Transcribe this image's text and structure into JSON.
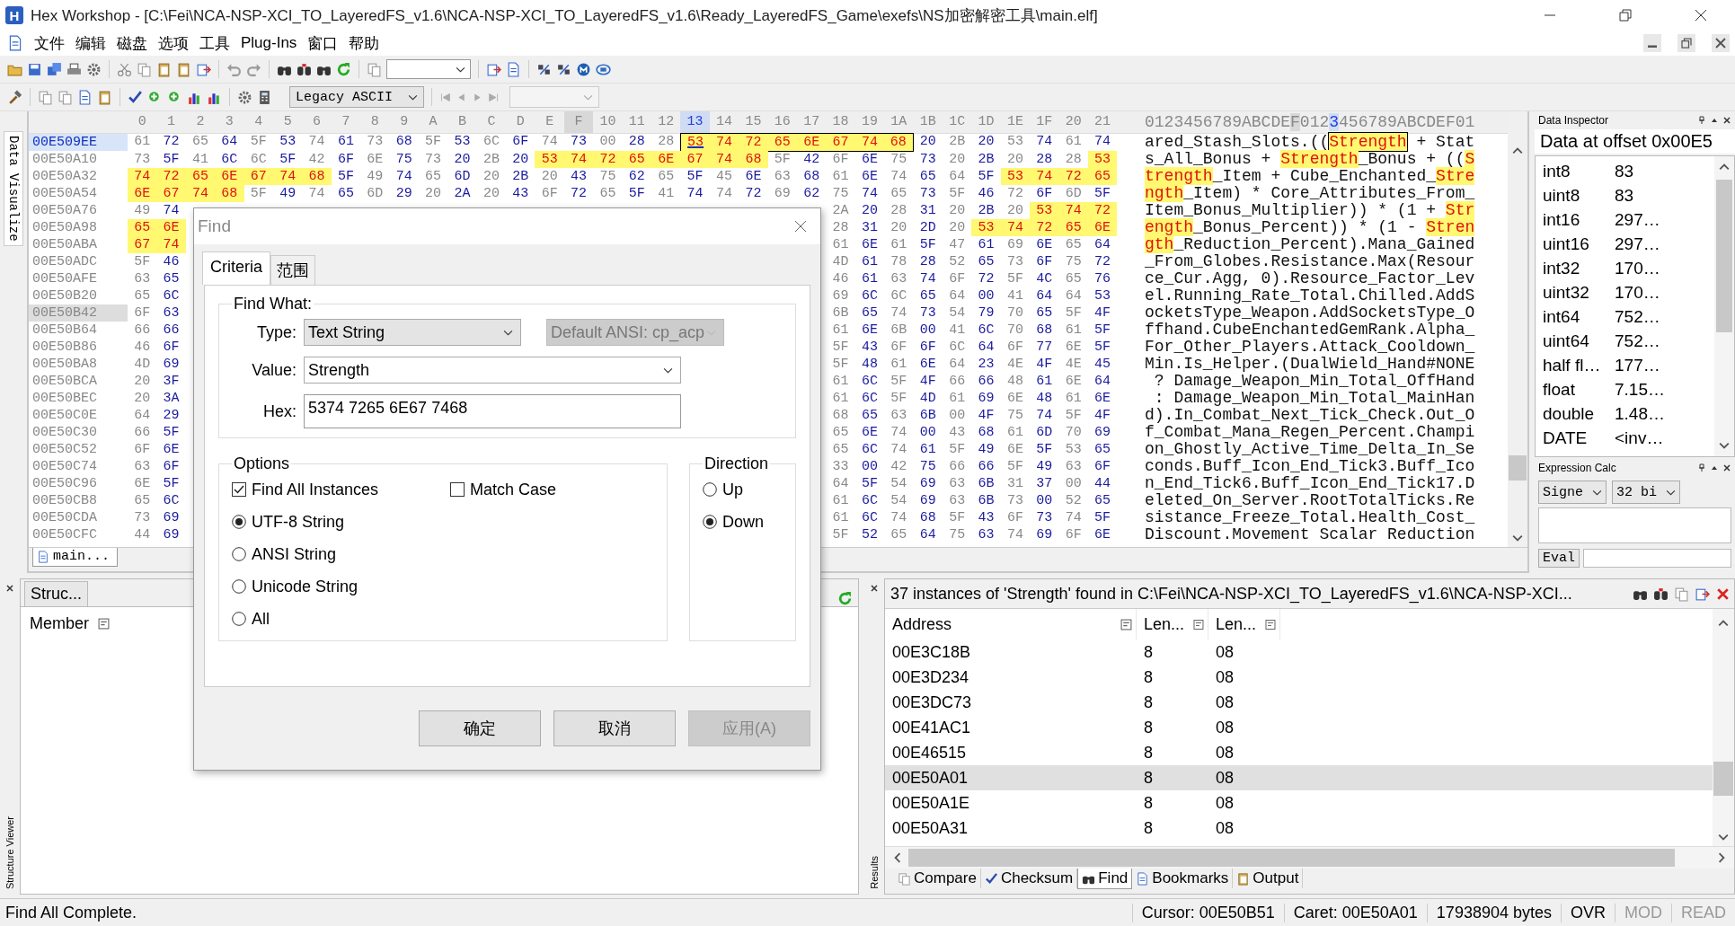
{
  "window": {
    "icon_letter": "H",
    "title": "Hex Workshop - [C:\\Fei\\NCA-NSP-XCI_TO_LayeredFS_v1.6\\NCA-NSP-XCI_TO_LayeredFS_v1.6\\Ready_LayeredFS_Game\\exefs\\NS加密解密工具\\main.elf]"
  },
  "menu": [
    "文件",
    "编辑",
    "磁盘",
    "选项",
    "工具",
    "Plug-Ins",
    "窗口",
    "帮助"
  ],
  "toolbar": {
    "charset": "Legacy ASCII"
  },
  "side_tabs": {
    "top": "Data Visualize",
    "structure": "Structure Viewer",
    "results": "Results"
  },
  "hex_editor": {
    "columns": [
      {
        "label": "0",
        "caret": false,
        "cursor": false
      },
      {
        "label": "1",
        "caret": false,
        "cursor": false
      },
      {
        "label": "2",
        "caret": false,
        "cursor": false
      },
      {
        "label": "3",
        "caret": false,
        "cursor": false
      },
      {
        "label": "4",
        "caret": false,
        "cursor": false
      },
      {
        "label": "5",
        "caret": false,
        "cursor": false
      },
      {
        "label": "6",
        "caret": false,
        "cursor": false
      },
      {
        "label": "7",
        "caret": false,
        "cursor": false
      },
      {
        "label": "8",
        "caret": false,
        "cursor": false
      },
      {
        "label": "9",
        "caret": false,
        "cursor": false
      },
      {
        "label": "A",
        "caret": false,
        "cursor": false
      },
      {
        "label": "B",
        "caret": false,
        "cursor": false
      },
      {
        "label": "C",
        "caret": false,
        "cursor": false
      },
      {
        "label": "D",
        "caret": false,
        "cursor": false
      },
      {
        "label": "E",
        "caret": false,
        "cursor": false
      },
      {
        "label": "F",
        "caret": false,
        "cursor": true
      },
      {
        "label": "10",
        "caret": false,
        "cursor": false
      },
      {
        "label": "11",
        "caret": false,
        "cursor": false
      },
      {
        "label": "12",
        "caret": false,
        "cursor": false
      },
      {
        "label": "13",
        "caret": true,
        "cursor": false
      },
      {
        "label": "14",
        "caret": false,
        "cursor": false
      },
      {
        "label": "15",
        "caret": false,
        "cursor": false
      },
      {
        "label": "16",
        "caret": false,
        "cursor": false
      },
      {
        "label": "17",
        "caret": false,
        "cursor": false
      },
      {
        "label": "18",
        "caret": false,
        "cursor": false
      },
      {
        "label": "19",
        "caret": false,
        "cursor": false
      },
      {
        "label": "1A",
        "caret": false,
        "cursor": false
      },
      {
        "label": "1B",
        "caret": false,
        "cursor": false
      },
      {
        "label": "1C",
        "caret": false,
        "cursor": false
      },
      {
        "label": "1D",
        "caret": false,
        "cursor": false
      },
      {
        "label": "1E",
        "caret": false,
        "cursor": false
      },
      {
        "label": "1F",
        "caret": false,
        "cursor": false
      },
      {
        "label": "20",
        "caret": false,
        "cursor": false
      },
      {
        "label": "21",
        "caret": false,
        "cursor": false
      }
    ],
    "ascii_header": [
      {
        "text": "0123456789ABCDE",
        "kind": "plain"
      },
      {
        "text": "F",
        "kind": "cursor"
      },
      {
        "text": "012",
        "kind": "plain"
      },
      {
        "text": "3",
        "kind": "caret"
      },
      {
        "text": "456789ABCDEF01",
        "kind": "plain"
      }
    ],
    "rows": [
      {
        "address": "00E509EE",
        "caret": true,
        "cursor": false,
        "hex": [
          {
            "bytes": [
              "61",
              "72",
              "65",
              "64",
              "5F",
              "53",
              "74",
              "61",
              "73",
              "68",
              "5F",
              "53",
              "6C",
              "6F",
              "74",
              "73",
              "00",
              "28",
              "28"
            ],
            "kind": "plain"
          },
          {
            "bytes": [
              "53",
              "74",
              "72",
              "65",
              "6E",
              "67",
              "74",
              "68"
            ],
            "kind": "current"
          },
          {
            "bytes": [
              "20",
              "2B",
              "20",
              "53",
              "74",
              "61",
              "74"
            ],
            "kind": "plain"
          }
        ],
        "ascii": [
          {
            "text": "ared_Stash_Slots.((",
            "kind": "plain"
          },
          {
            "text": "Strength",
            "kind": "current"
          },
          {
            "text": " + Stat",
            "kind": "plain"
          }
        ]
      },
      {
        "address": "00E50A10",
        "caret": false,
        "cursor": false,
        "hex": [
          {
            "bytes": [
              "73",
              "5F",
              "41",
              "6C",
              "6C",
              "5F",
              "42",
              "6F",
              "6E",
              "75",
              "73",
              "20",
              "2B",
              "20"
            ],
            "kind": "plain"
          },
          {
            "bytes": [
              "53",
              "74",
              "72",
              "65",
              "6E",
              "67",
              "74",
              "68"
            ],
            "kind": "match"
          },
          {
            "bytes": [
              "5F",
              "42",
              "6F",
              "6E",
              "75",
              "73",
              "20",
              "2B",
              "20",
              "28",
              "28"
            ],
            "kind": "plain"
          },
          {
            "bytes": [
              "53"
            ],
            "kind": "match"
          }
        ],
        "ascii": [
          {
            "text": "s_All_Bonus + ",
            "kind": "plain"
          },
          {
            "text": "Strength",
            "kind": "match"
          },
          {
            "text": "_Bonus + ((",
            "kind": "plain"
          },
          {
            "text": "S",
            "kind": "match"
          }
        ]
      },
      {
        "address": "00E50A32",
        "caret": false,
        "cursor": false,
        "hex": [
          {
            "bytes": [
              "74",
              "72",
              "65",
              "6E",
              "67",
              "74",
              "68"
            ],
            "kind": "match"
          },
          {
            "bytes": [
              "5F",
              "49",
              "74",
              "65",
              "6D",
              "20",
              "2B",
              "20",
              "43",
              "75",
              "62",
              "65",
              "5F",
              "45",
              "6E",
              "63",
              "68",
              "61",
              "6E",
              "74",
              "65",
              "64",
              "5F"
            ],
            "kind": "plain"
          },
          {
            "bytes": [
              "53",
              "74",
              "72",
              "65"
            ],
            "kind": "match"
          }
        ],
        "ascii": [
          {
            "text": "trength",
            "kind": "match"
          },
          {
            "text": "_Item + Cube_Enchanted_",
            "kind": "plain"
          },
          {
            "text": "Stre",
            "kind": "match"
          }
        ]
      },
      {
        "address": "00E50A54",
        "caret": false,
        "cursor": false,
        "hex": [
          {
            "bytes": [
              "6E",
              "67",
              "74",
              "68"
            ],
            "kind": "match"
          },
          {
            "bytes": [
              "5F",
              "49",
              "74",
              "65",
              "6D",
              "29",
              "20",
              "2A",
              "20",
              "43",
              "6F",
              "72",
              "65",
              "5F",
              "41",
              "74",
              "74",
              "72",
              "69",
              "62",
              "75",
              "74",
              "65",
              "73",
              "5F",
              "46",
              "72",
              "6F",
              "6D",
              "5F"
            ],
            "kind": "plain"
          }
        ],
        "ascii": [
          {
            "text": "ngth",
            "kind": "match"
          },
          {
            "text": "_Item) * Core_Attributes_From_",
            "kind": "plain"
          }
        ]
      },
      {
        "address": "00E50A76",
        "caret": false,
        "cursor": false,
        "hex_start": [
          {
            "bytes": [
              "49",
              "74"
            ],
            "kind": "plain"
          }
        ],
        "hex_end": [
          {
            "bytes": [
              "2A",
              "20",
              "28",
              "31",
              "20",
              "2B",
              "20"
            ],
            "kind": "plain"
          },
          {
            "bytes": [
              "53",
              "74",
              "72"
            ],
            "kind": "match"
          }
        ],
        "ascii": [
          {
            "text": "Item_Bonus_Multiplier)) * (1 + ",
            "kind": "plain"
          },
          {
            "text": "Str",
            "kind": "match"
          }
        ]
      },
      {
        "address": "00E50A98",
        "caret": false,
        "cursor": false,
        "hex_start": [
          {
            "bytes": [
              "65",
              "6E"
            ],
            "kind": "match"
          }
        ],
        "hex_end": [
          {
            "bytes": [
              "28",
              "31",
              "20",
              "2D",
              "20"
            ],
            "kind": "plain"
          },
          {
            "bytes": [
              "53",
              "74",
              "72",
              "65",
              "6E"
            ],
            "kind": "match"
          }
        ],
        "ascii": [
          {
            "text": "ength",
            "kind": "match"
          },
          {
            "text": "_Bonus_Percent)) * (1 - ",
            "kind": "plain"
          },
          {
            "text": "Stren",
            "kind": "match"
          }
        ]
      },
      {
        "address": "00E50ABA",
        "caret": false,
        "cursor": false,
        "hex_start": [
          {
            "bytes": [
              "67",
              "74"
            ],
            "kind": "match"
          }
        ],
        "hex_end": [
          {
            "bytes": [
              "61",
              "6E",
              "61",
              "5F",
              "47",
              "61",
              "69",
              "6E",
              "65",
              "64"
            ],
            "kind": "plain"
          }
        ],
        "ascii": [
          {
            "text": "gth",
            "kind": "match"
          },
          {
            "text": "_Reduction_Percent).Mana_Gained",
            "kind": "plain"
          }
        ]
      },
      {
        "address": "00E50ADC",
        "caret": false,
        "cursor": false,
        "hex_start": [
          {
            "bytes": [
              "5F",
              "46"
            ],
            "kind": "plain"
          }
        ],
        "hex_end": [
          {
            "bytes": [
              "4D",
              "61",
              "78",
              "28",
              "52",
              "65",
              "73",
              "6F",
              "75",
              "72"
            ],
            "kind": "plain"
          }
        ],
        "ascii": [
          {
            "text": "_From_Globes.Resistance.Max(Resour",
            "kind": "plain"
          }
        ]
      },
      {
        "address": "00E50AFE",
        "caret": false,
        "cursor": false,
        "hex_start": [
          {
            "bytes": [
              "63",
              "65"
            ],
            "kind": "plain"
          }
        ],
        "hex_end": [
          {
            "bytes": [
              "46",
              "61",
              "63",
              "74",
              "6F",
              "72",
              "5F",
              "4C",
              "65",
              "76"
            ],
            "kind": "plain"
          }
        ],
        "ascii": [
          {
            "text": "ce_Cur.Agg, 0).Resource_Factor_Lev",
            "kind": "plain"
          }
        ]
      },
      {
        "address": "00E50B20",
        "caret": false,
        "cursor": false,
        "hex_start": [
          {
            "bytes": [
              "65",
              "6C"
            ],
            "kind": "plain"
          }
        ],
        "hex_end": [
          {
            "bytes": [
              "69",
              "6C",
              "6C",
              "65",
              "64",
              "00",
              "41",
              "64",
              "64",
              "53"
            ],
            "kind": "plain"
          }
        ],
        "ascii": [
          {
            "text": "el.Running_Rate_Total.Chilled.AddS",
            "kind": "plain"
          }
        ]
      },
      {
        "address": "00E50B42",
        "caret": false,
        "cursor": true,
        "hex_start": [
          {
            "bytes": [
              "6F",
              "63"
            ],
            "kind": "plain"
          }
        ],
        "hex_end": [
          {
            "bytes": [
              "6B",
              "65",
              "74",
              "73",
              "54",
              "79",
              "70",
              "65",
              "5F",
              "4F"
            ],
            "kind": "plain"
          }
        ],
        "ascii": [
          {
            "text": "ocketsType_Weapon.AddSocketsType_O",
            "kind": "plain"
          }
        ]
      },
      {
        "address": "00E50B64",
        "caret": false,
        "cursor": false,
        "hex_start": [
          {
            "bytes": [
              "66",
              "66"
            ],
            "kind": "plain"
          }
        ],
        "hex_end": [
          {
            "bytes": [
              "61",
              "6E",
              "6B",
              "00",
              "41",
              "6C",
              "70",
              "68",
              "61",
              "5F"
            ],
            "kind": "plain"
          }
        ],
        "ascii": [
          {
            "text": "ffhand.CubeEnchantedGemRank.Alpha_",
            "kind": "plain"
          }
        ]
      },
      {
        "address": "00E50B86",
        "caret": false,
        "cursor": false,
        "hex_start": [
          {
            "bytes": [
              "46",
              "6F"
            ],
            "kind": "plain"
          }
        ],
        "hex_end": [
          {
            "bytes": [
              "5F",
              "43",
              "6F",
              "6F",
              "6C",
              "64",
              "6F",
              "77",
              "6E",
              "5F"
            ],
            "kind": "plain"
          }
        ],
        "ascii": [
          {
            "text": "For_Other_Players.Attack_Cooldown_",
            "kind": "plain"
          }
        ]
      },
      {
        "address": "00E50BA8",
        "caret": false,
        "cursor": false,
        "hex_start": [
          {
            "bytes": [
              "4D",
              "69"
            ],
            "kind": "plain"
          }
        ],
        "hex_end": [
          {
            "bytes": [
              "5F",
              "48",
              "61",
              "6E",
              "64",
              "23",
              "4E",
              "4F",
              "4E",
              "45"
            ],
            "kind": "plain"
          }
        ],
        "ascii": [
          {
            "text": "Min.Is_Helper.(DualWield_Hand#NONE",
            "kind": "plain"
          }
        ]
      },
      {
        "address": "00E50BCA",
        "caret": false,
        "cursor": false,
        "hex_start": [
          {
            "bytes": [
              "20",
              "3F"
            ],
            "kind": "plain"
          }
        ],
        "hex_end": [
          {
            "bytes": [
              "61",
              "6C",
              "5F",
              "4F",
              "66",
              "66",
              "48",
              "61",
              "6E",
              "64"
            ],
            "kind": "plain"
          }
        ],
        "ascii": [
          {
            "text": " ? Damage_Weapon_Min_Total_OffHand",
            "kind": "plain"
          }
        ]
      },
      {
        "address": "00E50BEC",
        "caret": false,
        "cursor": false,
        "hex_start": [
          {
            "bytes": [
              "20",
              "3A"
            ],
            "kind": "plain"
          }
        ],
        "hex_end": [
          {
            "bytes": [
              "61",
              "6C",
              "5F",
              "4D",
              "61",
              "69",
              "6E",
              "48",
              "61",
              "6E"
            ],
            "kind": "plain"
          }
        ],
        "ascii": [
          {
            "text": " : Damage_Weapon_Min_Total_MainHan",
            "kind": "plain"
          }
        ]
      },
      {
        "address": "00E50C0E",
        "caret": false,
        "cursor": false,
        "hex_start": [
          {
            "bytes": [
              "64",
              "29"
            ],
            "kind": "plain"
          }
        ],
        "hex_end": [
          {
            "bytes": [
              "68",
              "65",
              "63",
              "6B",
              "00",
              "4F",
              "75",
              "74",
              "5F",
              "4F"
            ],
            "kind": "plain"
          }
        ],
        "ascii": [
          {
            "text": "d).In_Combat_Next_Tick_Check.Out_O",
            "kind": "plain"
          }
        ]
      },
      {
        "address": "00E50C30",
        "caret": false,
        "cursor": false,
        "hex_start": [
          {
            "bytes": [
              "66",
              "5F"
            ],
            "kind": "plain"
          }
        ],
        "hex_end": [
          {
            "bytes": [
              "65",
              "6E",
              "74",
              "00",
              "43",
              "68",
              "61",
              "6D",
              "70",
              "69"
            ],
            "kind": "plain"
          }
        ],
        "ascii": [
          {
            "text": "f_Combat_Mana_Regen_Percent.Champi",
            "kind": "plain"
          }
        ]
      },
      {
        "address": "00E50C52",
        "caret": false,
        "cursor": false,
        "hex_start": [
          {
            "bytes": [
              "6F",
              "6E"
            ],
            "kind": "plain"
          }
        ],
        "hex_end": [
          {
            "bytes": [
              "65",
              "6C",
              "74",
              "61",
              "5F",
              "49",
              "6E",
              "5F",
              "53",
              "65"
            ],
            "kind": "plain"
          }
        ],
        "ascii": [
          {
            "text": "on_Ghostly_Active_Time_Delta_In_Se",
            "kind": "plain"
          }
        ]
      },
      {
        "address": "00E50C74",
        "caret": false,
        "cursor": false,
        "hex_start": [
          {
            "bytes": [
              "63",
              "6F"
            ],
            "kind": "plain"
          }
        ],
        "hex_end": [
          {
            "bytes": [
              "33",
              "00",
              "42",
              "75",
              "66",
              "66",
              "5F",
              "49",
              "63",
              "6F"
            ],
            "kind": "plain"
          }
        ],
        "ascii": [
          {
            "text": "conds.Buff_Icon_End_Tick3.Buff_Ico",
            "kind": "plain"
          }
        ]
      },
      {
        "address": "00E50C96",
        "caret": false,
        "cursor": false,
        "hex_start": [
          {
            "bytes": [
              "6E",
              "5F"
            ],
            "kind": "plain"
          }
        ],
        "hex_end": [
          {
            "bytes": [
              "64",
              "5F",
              "54",
              "69",
              "63",
              "6B",
              "31",
              "37",
              "00",
              "44"
            ],
            "kind": "plain"
          }
        ],
        "ascii": [
          {
            "text": "n_End_Tick6.Buff_Icon_End_Tick17.D",
            "kind": "plain"
          }
        ]
      },
      {
        "address": "00E50CB8",
        "caret": false,
        "cursor": false,
        "hex_start": [
          {
            "bytes": [
              "65",
              "6C"
            ],
            "kind": "plain"
          }
        ],
        "hex_end": [
          {
            "bytes": [
              "61",
              "6C",
              "54",
              "69",
              "63",
              "6B",
              "73",
              "00",
              "52",
              "65"
            ],
            "kind": "plain"
          }
        ],
        "ascii": [
          {
            "text": "eleted_On_Server.RootTotalTicks.Re",
            "kind": "plain"
          }
        ]
      },
      {
        "address": "00E50CDA",
        "caret": false,
        "cursor": false,
        "hex_start": [
          {
            "bytes": [
              "73",
              "69"
            ],
            "kind": "plain"
          }
        ],
        "hex_end": [
          {
            "bytes": [
              "61",
              "6C",
              "74",
              "68",
              "5F",
              "43",
              "6F",
              "73",
              "74",
              "5F"
            ],
            "kind": "plain"
          }
        ],
        "ascii": [
          {
            "text": "sistance_Freeze_Total.Health_Cost_",
            "kind": "plain"
          }
        ]
      },
      {
        "address": "00E50CFC",
        "caret": false,
        "cursor": false,
        "hex_start": [
          {
            "bytes": [
              "44",
              "69"
            ],
            "kind": "plain"
          }
        ],
        "hex_end": [
          {
            "bytes": [
              "5F",
              "52",
              "65",
              "64",
              "75",
              "63",
              "74",
              "69",
              "6F",
              "6E"
            ],
            "kind": "plain"
          }
        ],
        "ascii": [
          {
            "text": "Discount.Movement Scalar Reduction",
            "kind": "plain"
          }
        ]
      }
    ],
    "document_tab": "main..."
  },
  "data_inspector": {
    "title": "Data Inspector",
    "heading": "Data at offset 0x00E5",
    "rows": [
      {
        "type": "int8",
        "value": "83"
      },
      {
        "type": "uint8",
        "value": "83"
      },
      {
        "type": "int16",
        "value": "297…"
      },
      {
        "type": "uint16",
        "value": "297…"
      },
      {
        "type": "int32",
        "value": "170…"
      },
      {
        "type": "uint32",
        "value": "170…"
      },
      {
        "type": "int64",
        "value": "752…"
      },
      {
        "type": "uint64",
        "value": "752…"
      },
      {
        "type": "half fl…",
        "value": "177…"
      },
      {
        "type": "float",
        "value": "7.15…"
      },
      {
        "type": "double",
        "value": "1.48…"
      },
      {
        "type": "DATE",
        "value": "<inv…"
      }
    ]
  },
  "expression_calc": {
    "title": "Expression Calc",
    "sign": "Signe",
    "bits": "32 bi",
    "eval": "Eval"
  },
  "structure_viewer": {
    "tab": "Struc...",
    "column": "Member"
  },
  "results": {
    "summary": "37 instances of 'Strength' found in C:\\Fei\\NCA-NSP-XCI_TO_LayeredFS_v1.6\\NCA-NSP-XCI...",
    "columns": [
      "Address",
      "Len...",
      "Len..."
    ],
    "rows": [
      {
        "address": "00E3C18B",
        "length": "8",
        "length_hex": "08",
        "selected": false
      },
      {
        "address": "00E3D234",
        "length": "8",
        "length_hex": "08",
        "selected": false
      },
      {
        "address": "00E3DC73",
        "length": "8",
        "length_hex": "08",
        "selected": false
      },
      {
        "address": "00E41AC1",
        "length": "8",
        "length_hex": "08",
        "selected": false
      },
      {
        "address": "00E46515",
        "length": "8",
        "length_hex": "08",
        "selected": false
      },
      {
        "address": "00E50A01",
        "length": "8",
        "length_hex": "08",
        "selected": true
      },
      {
        "address": "00E50A1E",
        "length": "8",
        "length_hex": "08",
        "selected": false
      },
      {
        "address": "00E50A31",
        "length": "8",
        "length_hex": "08",
        "selected": false
      }
    ],
    "tabs": [
      {
        "label": "Compare",
        "selected": false
      },
      {
        "label": "Checksum",
        "selected": false
      },
      {
        "label": "Find",
        "selected": true
      },
      {
        "label": "Bookmarks",
        "selected": false
      },
      {
        "label": "Output",
        "selected": false
      }
    ]
  },
  "status_bar": {
    "message": "Find All Complete.",
    "items": [
      {
        "text": "Cursor: 00E50B51",
        "active": true
      },
      {
        "text": "Caret: 00E50A01",
        "active": true
      },
      {
        "text": "17938904 bytes",
        "active": true
      },
      {
        "text": "OVR",
        "active": true
      },
      {
        "text": "MOD",
        "active": false
      },
      {
        "text": "READ",
        "active": false
      }
    ]
  },
  "find_dialog": {
    "title": "Find",
    "tabs": [
      {
        "label": "Criteria",
        "selected": true
      },
      {
        "label": "范围",
        "selected": false
      }
    ],
    "find_what": {
      "title": "Find What:",
      "type_label": "Type:",
      "type_value": "Text String",
      "encoding": {
        "value": "Default ANSI: cp_acp",
        "disabled": true
      },
      "value_label": "Value:",
      "value": "Strength",
      "hex_label": "Hex:",
      "hex": "5374 7265 6E67 7468"
    },
    "options": {
      "title": "Options",
      "checkboxes": [
        {
          "label": "Find All Instances",
          "checked": true
        },
        {
          "label": "Match Case",
          "checked": false
        }
      ],
      "radios": [
        {
          "label": "UTF-8 String",
          "selected": true
        },
        {
          "label": "ANSI String",
          "selected": false
        },
        {
          "label": "Unicode String",
          "selected": false
        },
        {
          "label": "All",
          "selected": false
        }
      ]
    },
    "direction": {
      "title": "Direction",
      "radios": [
        {
          "label": "Up",
          "selected": false
        },
        {
          "label": "Down",
          "selected": true
        }
      ]
    },
    "buttons": [
      {
        "label": "确定",
        "disabled": false
      },
      {
        "label": "取消",
        "disabled": false
      },
      {
        "label": "应用(A)",
        "disabled": true
      }
    ]
  }
}
